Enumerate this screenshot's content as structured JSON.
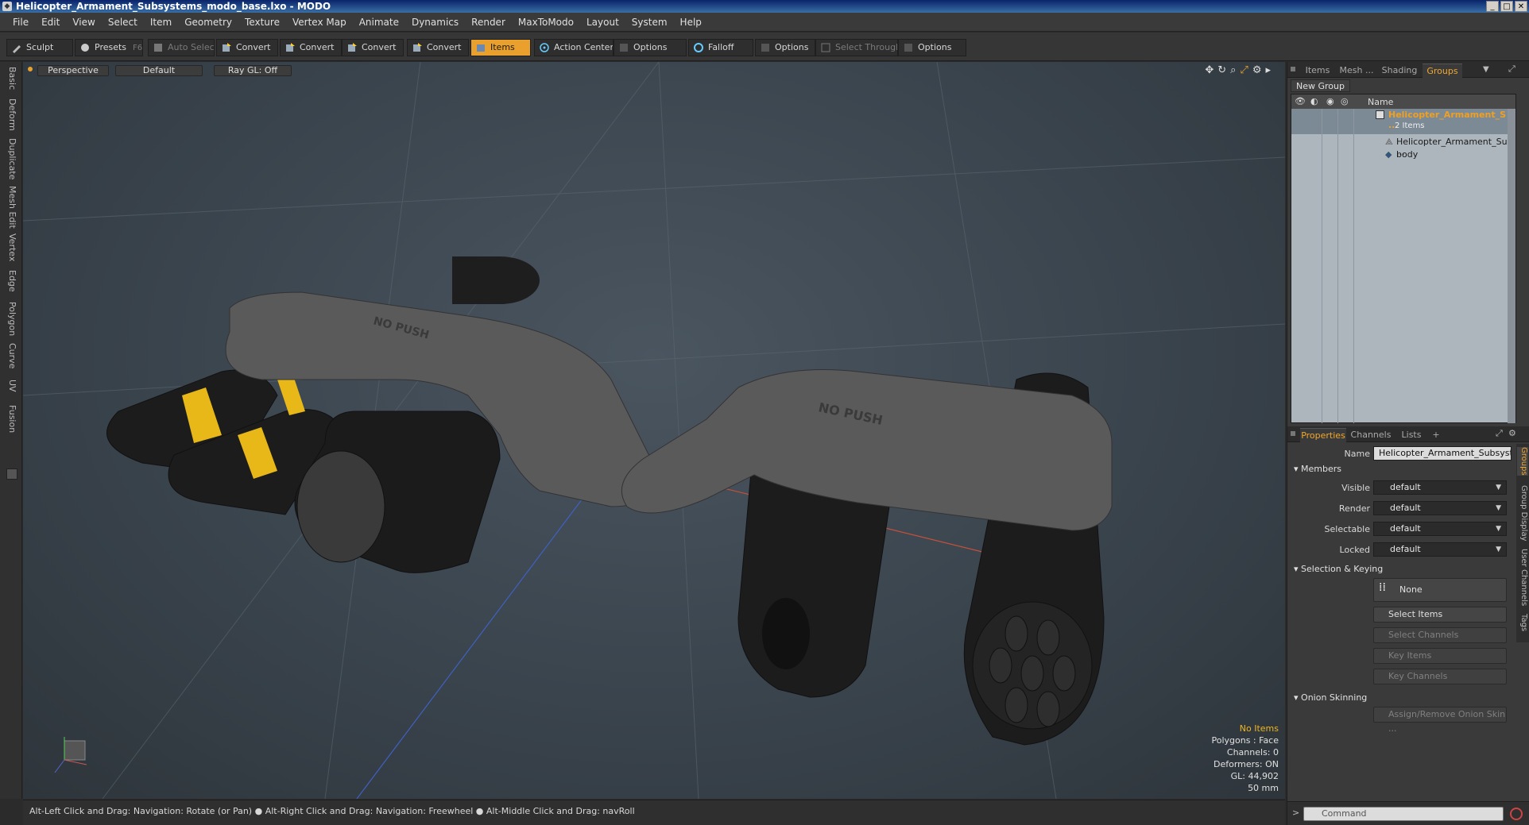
{
  "window": {
    "title": "Helicopter_Armament_Subsystems_modo_base.lxo - MODO",
    "app_icon": "modo-icon",
    "minimize": "_",
    "maximize": "□",
    "close": "✕"
  },
  "menu": [
    "File",
    "Edit",
    "View",
    "Select",
    "Item",
    "Geometry",
    "Texture",
    "Vertex Map",
    "Animate",
    "Dynamics",
    "Render",
    "MaxToModo",
    "Layout",
    "System",
    "Help"
  ],
  "toolbar": {
    "sculpt": "Sculpt",
    "presets": "Presets",
    "presets_key": "F6",
    "auto_select": "Auto Select",
    "convert1": "Convert",
    "convert2": "Convert",
    "convert3": "Convert",
    "convert4": "Convert",
    "items": "Items",
    "action_center": "Action Center",
    "options1": "Options",
    "falloff": "Falloff",
    "options2": "Options",
    "select_through": "Select Through",
    "options3": "Options"
  },
  "left_tabs": [
    "Basic",
    "Deform",
    "Duplicate",
    "Mesh Edit",
    "Vertex",
    "Edge",
    "Polygon",
    "Curve",
    "UV",
    "Fusion"
  ],
  "viewport": {
    "view": "Perspective",
    "shading": "Default",
    "raygl": "Ray GL: Off",
    "decal_text": "NO PUSH",
    "info": {
      "selection": "No Items",
      "polygons": "Polygons : Face",
      "channels": "Channels: 0",
      "deformers": "Deformers: ON",
      "gl": "GL: 44,902",
      "scale": "50 mm"
    }
  },
  "status": {
    "hint1": "Alt-Left Click and Drag: Navigation: Rotate (or Pan)",
    "hint2": "Alt-Right Click and Drag: Navigation: Freewheel",
    "hint3": "Alt-Middle Click and Drag: navRoll",
    "sep": "●"
  },
  "right_panel": {
    "top_tabs": [
      "Items",
      "Mesh ...",
      "Shading",
      "Groups"
    ],
    "new_group": "New Group",
    "col_name": "Name",
    "group_name": "Helicopter_Armament_S ...",
    "group_count": "2 Items",
    "children": [
      "Helicopter_Armament_Sub ...",
      "body"
    ],
    "prop_tabs": [
      "Properties",
      "Channels",
      "Lists",
      "+"
    ],
    "props": {
      "name_label": "Name",
      "name_value": "Helicopter_Armament_Subsystems",
      "members": "Members",
      "visible_label": "Visible",
      "visible_value": "default",
      "render_label": "Render",
      "render_value": "default",
      "selectable_label": "Selectable",
      "selectable_value": "default",
      "locked_label": "Locked",
      "locked_value": "default",
      "sel_keying": "Selection & Keying",
      "none": "None",
      "select_items": "Select Items",
      "select_channels": "Select Channels",
      "key_items": "Key Items",
      "key_channels": "Key Channels",
      "onion": "Onion Skinning",
      "assign_onion": "Assign/Remove Onion Skin ..."
    },
    "side_tabs": [
      "Groups",
      "Group Display",
      "User Channels",
      "Tags"
    ],
    "command_placeholder": "Command"
  },
  "colors": {
    "accent": "#e9a02c",
    "warn_text": "#f1b51e",
    "viewport_bg": "#3a444d",
    "grid_red": "#c8503a",
    "grid_blue": "#4060c0"
  }
}
